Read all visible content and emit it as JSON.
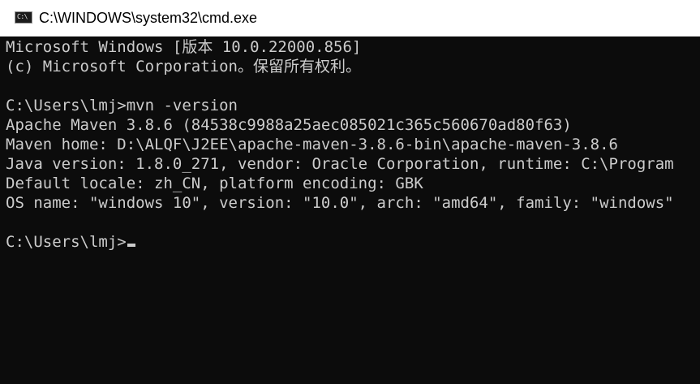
{
  "window": {
    "title": "C:\\WINDOWS\\system32\\cmd.exe",
    "icon": "cmd-icon",
    "icon_glyph": "C:\\"
  },
  "console": {
    "lines": [
      "Microsoft Windows [版本 10.0.22000.856]",
      "(c) Microsoft Corporation。保留所有权利。",
      "",
      "C:\\Users\\lmj>mvn -version",
      "Apache Maven 3.8.6 (84538c9988a25aec085021c365c560670ad80f63)",
      "Maven home: D:\\ALQF\\J2EE\\apache-maven-3.8.6-bin\\apache-maven-3.8.6",
      "Java version: 1.8.0_271, vendor: Oracle Corporation, runtime: C:\\Program",
      "Default locale: zh_CN, platform encoding: GBK",
      "OS name: \"windows 10\", version: \"10.0\", arch: \"amd64\", family: \"windows\"",
      "",
      "C:\\Users\\lmj>"
    ]
  },
  "colors": {
    "console_background": "#0c0c0c",
    "console_text": "#cccccc",
    "titlebar_background": "#ffffff"
  }
}
